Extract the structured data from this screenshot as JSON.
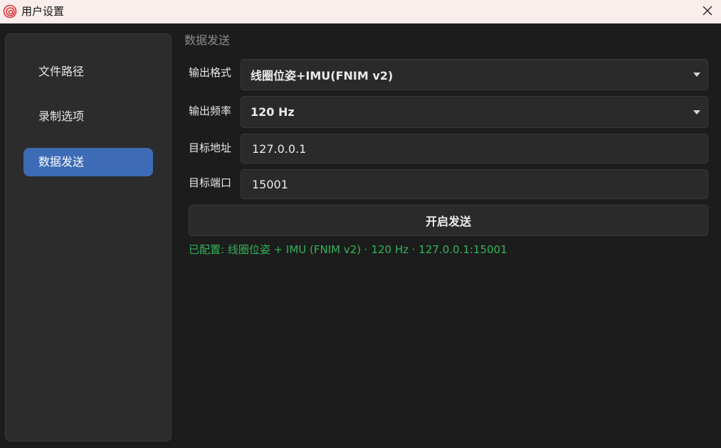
{
  "window": {
    "title": "用户设置",
    "icon": "swirl-logo-icon",
    "close_icon": "close-icon",
    "titlebar_color": "#f9eeec"
  },
  "sidebar": {
    "items": [
      {
        "label": "文件路径",
        "active": false
      },
      {
        "label": "录制选项",
        "active": false
      },
      {
        "label": "数据发送",
        "active": true
      }
    ],
    "accent_color": "#3e6bb5"
  },
  "main": {
    "section_title": "数据发送",
    "output_format": {
      "label": "输出格式",
      "value": "线圈位姿+IMU(FNIM v2)"
    },
    "output_rate": {
      "label": "输出频率",
      "value": "120 Hz"
    },
    "target_address": {
      "label": "目标地址",
      "value": "127.0.0.1"
    },
    "target_port": {
      "label": "目标端口",
      "value": "15001"
    },
    "send_button_label": "开启发送",
    "status_text": "已配置: 线圈位姿 + IMU (FNIM v2) · 120 Hz · 127.0.0.1:15001",
    "status_color": "#33b35a"
  }
}
